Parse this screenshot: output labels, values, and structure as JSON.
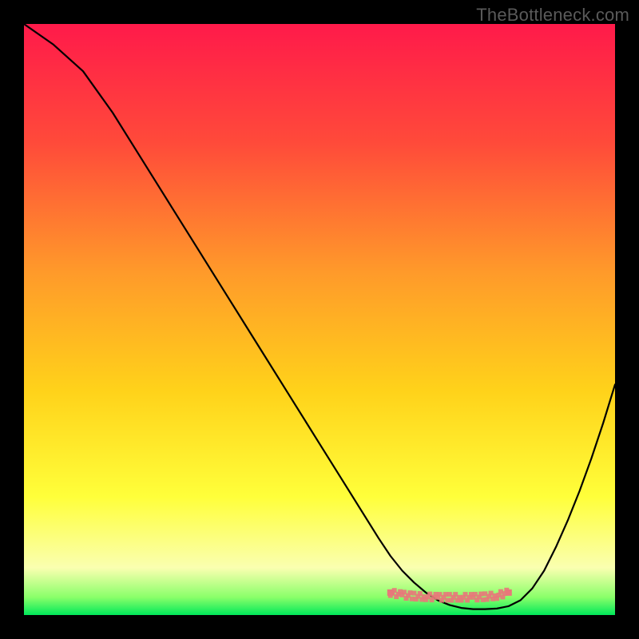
{
  "watermark": "TheBottleneck.com",
  "chart_data": {
    "type": "line",
    "title": "",
    "xlabel": "",
    "ylabel": "",
    "xlim": [
      0,
      100
    ],
    "ylim": [
      0,
      100
    ],
    "grid": false,
    "legend": false,
    "gradient_stops": [
      {
        "offset": 0,
        "color": "#ff1a4a"
      },
      {
        "offset": 20,
        "color": "#ff4a3a"
      },
      {
        "offset": 42,
        "color": "#ff9a2a"
      },
      {
        "offset": 62,
        "color": "#ffd21a"
      },
      {
        "offset": 80,
        "color": "#ffff3a"
      },
      {
        "offset": 92,
        "color": "#faffb0"
      },
      {
        "offset": 97,
        "color": "#8aff6a"
      },
      {
        "offset": 100,
        "color": "#00e85a"
      }
    ],
    "series": [
      {
        "name": "bottleneck-curve",
        "color": "#000000",
        "x": [
          0,
          5,
          10,
          15,
          20,
          25,
          30,
          35,
          40,
          45,
          50,
          55,
          60,
          62,
          64,
          66,
          68,
          70,
          72,
          74,
          76,
          78,
          80,
          82,
          84,
          86,
          88,
          90,
          92,
          94,
          96,
          98,
          100
        ],
        "y": [
          100,
          96.5,
          92,
          85,
          77,
          69,
          61,
          53,
          45,
          37,
          29,
          21,
          13,
          10,
          7.5,
          5.5,
          3.8,
          2.5,
          1.7,
          1.2,
          1.0,
          1.0,
          1.1,
          1.5,
          2.5,
          4.5,
          7.5,
          11.5,
          16,
          21,
          26.5,
          32.5,
          39
        ]
      },
      {
        "name": "optimal-marker",
        "color": "#e8787a",
        "style": "dotted-band",
        "x": [
          62,
          64,
          66,
          68,
          70,
          72,
          74,
          76,
          78,
          80,
          82
        ],
        "y": [
          3.8,
          3.4,
          3.2,
          3.1,
          3.0,
          3.0,
          3.0,
          3.0,
          3.1,
          3.3,
          3.8
        ]
      }
    ]
  }
}
